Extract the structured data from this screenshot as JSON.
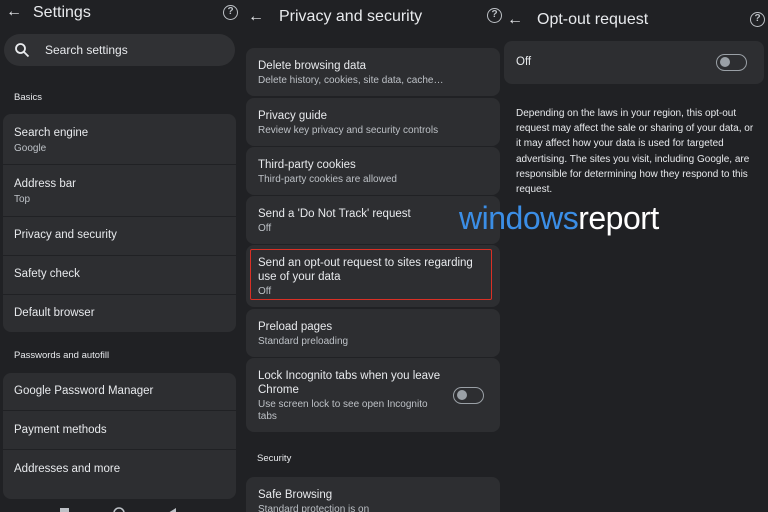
{
  "settings_panel": {
    "title": "Settings",
    "search_placeholder": "Search settings",
    "basics_header": "Basics",
    "basics_items": [
      {
        "label": "Search engine",
        "sub": "Google"
      },
      {
        "label": "Address bar",
        "sub": "Top"
      },
      {
        "label": "Privacy and security",
        "sub": ""
      },
      {
        "label": "Safety check",
        "sub": ""
      },
      {
        "label": "Default browser",
        "sub": ""
      }
    ],
    "passwords_header": "Passwords and autofill",
    "passwords_items": [
      {
        "label": "Google Password Manager"
      },
      {
        "label": "Payment methods"
      },
      {
        "label": "Addresses and more"
      }
    ]
  },
  "privacy_panel": {
    "title": "Privacy and security",
    "items": [
      {
        "label": "Delete browsing data",
        "sub": "Delete history, cookies, site data, cache…"
      },
      {
        "label": "Privacy guide",
        "sub": "Review key privacy and security controls"
      },
      {
        "label": "Third-party cookies",
        "sub": "Third-party cookies are allowed"
      },
      {
        "label": "Send a 'Do Not Track' request",
        "sub": "Off"
      },
      {
        "label": "Send an opt-out request to sites regarding use of your data",
        "sub": "Off"
      },
      {
        "label": "Preload pages",
        "sub": "Standard preloading"
      },
      {
        "label": "Lock Incognito tabs when you leave Chrome",
        "sub": "Use screen lock to see open Incognito tabs",
        "toggle": "off"
      }
    ],
    "security_header": "Security",
    "security_items": [
      {
        "label": "Safe Browsing",
        "sub": "Standard protection is on"
      }
    ]
  },
  "optout_panel": {
    "title": "Opt-out request",
    "toggle_label": "Off",
    "toggle_state": "off",
    "description": "Depending on the laws in your region, this opt-out request may affect the sale or sharing of your data, or it may affect how your data is used for targeted advertising. The sites you visit, including Google, are responsible for determining how they respond to this request."
  },
  "watermark": {
    "part1": "windows",
    "part2": "report"
  },
  "colors": {
    "background": "#202124",
    "card": "#2d2e31",
    "highlight": "#d93025",
    "watermark_blue": "#3b8ee6"
  }
}
